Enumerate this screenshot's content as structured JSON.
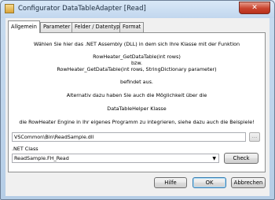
{
  "window": {
    "title": "Configurator DataTableAdapter [Read]",
    "close_label": "✕"
  },
  "tabs": [
    {
      "label": "Allgemein",
      "active": true
    },
    {
      "label": "Parameter",
      "active": false
    },
    {
      "label": "Felder / Datentypen",
      "active": false
    },
    {
      "label": "Format",
      "active": false
    }
  ],
  "content": {
    "line1": "Wählen Sie hier das .NET Assembly (DLL) in dem sich Ihre Klasse mit der Funktion",
    "line2": "RowHeater_GetDataTable(int rows)",
    "line3": "bzw.",
    "line4": "RowHeater_GetDataTable(int rows, StringDictionary parameter)",
    "line5": "befindet aus.",
    "line6": "Alternativ dazu haben Sie auch die Möglichkeit über die",
    "line7": "DataTableHelper Klasse",
    "line8": "die RowHeater Engine in Ihr eigenes Programm zu integrieren, siehe dazu auch die Beispiele!"
  },
  "assembly": {
    "value": "VSCommon\\Bin\\ReadSample.dll",
    "browse_label": "..."
  },
  "net_class": {
    "label": ".NET Class",
    "selected": "ReadSample.FH_Read",
    "arrow": "▼",
    "check_label": "Check"
  },
  "buttons": {
    "help": "Hilfe",
    "ok": "OK",
    "cancel": "Abbrechen"
  }
}
